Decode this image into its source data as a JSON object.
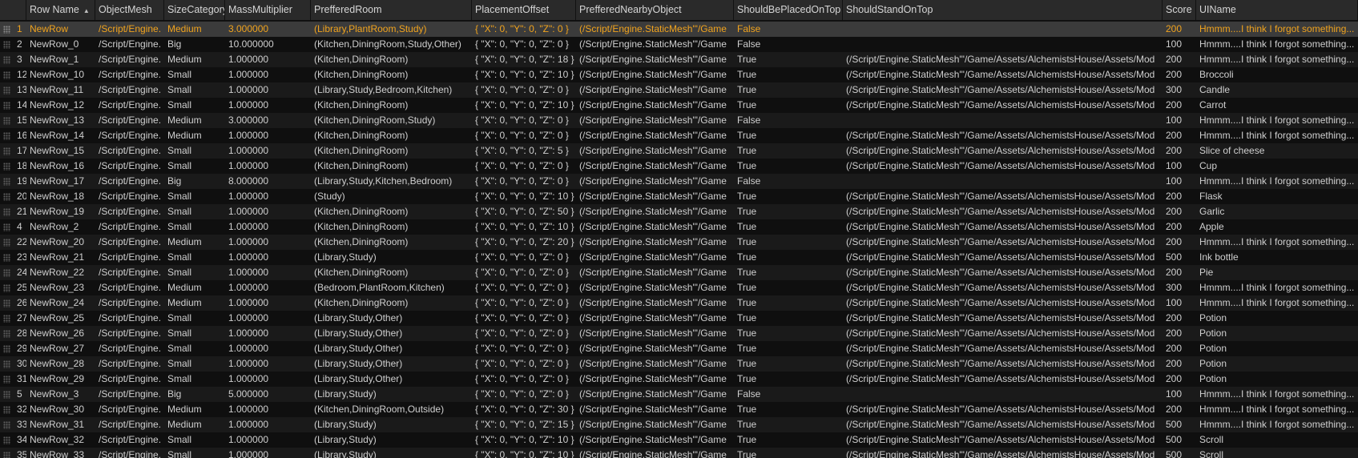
{
  "columns": [
    {
      "key": "rowname",
      "label": "Row Name"
    },
    {
      "key": "mesh",
      "label": "ObjectMesh"
    },
    {
      "key": "size",
      "label": "SizeCategory"
    },
    {
      "key": "mass",
      "label": "MassMultiplier"
    },
    {
      "key": "room",
      "label": "PrefferedRoom"
    },
    {
      "key": "offset",
      "label": "PlacementOffset"
    },
    {
      "key": "nearby",
      "label": "PrefferedNearbyObject"
    },
    {
      "key": "placed",
      "label": "ShouldBePlacedOnTop"
    },
    {
      "key": "stand",
      "label": "ShouldStandOnTop"
    },
    {
      "key": "score",
      "label": "Score"
    },
    {
      "key": "uiname",
      "label": "UIName"
    }
  ],
  "sort": {
    "column": "Row Name",
    "direction": "ascending",
    "indicator": "▲"
  },
  "selected_row_index": 0,
  "rows": [
    {
      "idx": "1",
      "rowname": "NewRow",
      "mesh": "/Script/Engine.",
      "size": "Medium",
      "mass": "3.000000",
      "room": "(Library,PlantRoom,Study)",
      "offset": "{ \"X\": 0, \"Y\": 0, \"Z\": 0 }",
      "nearby": "(/Script/Engine.StaticMesh'\"/Game",
      "placed": "False",
      "stand": "",
      "score": "200",
      "uiname": "Hmmm....I think I forgot something..."
    },
    {
      "idx": "2",
      "rowname": "NewRow_0",
      "mesh": "/Script/Engine.",
      "size": "Big",
      "mass": "10.000000",
      "room": "(Kitchen,DiningRoom,Study,Other)",
      "offset": "{ \"X\": 0, \"Y\": 0, \"Z\": 0 }",
      "nearby": "(/Script/Engine.StaticMesh'\"/Game",
      "placed": "False",
      "stand": "",
      "score": "100",
      "uiname": "Hmmm....I think I forgot something..."
    },
    {
      "idx": "3",
      "rowname": "NewRow_1",
      "mesh": "/Script/Engine.",
      "size": "Medium",
      "mass": "1.000000",
      "room": "(Kitchen,DiningRoom)",
      "offset": "{ \"X\": 0, \"Y\": 0, \"Z\": 18 }",
      "nearby": "(/Script/Engine.StaticMesh'\"/Game",
      "placed": "True",
      "stand": "(/Script/Engine.StaticMesh'\"/Game/Assets/AlchemistsHouse/Assets/Mod",
      "score": "200",
      "uiname": "Hmmm....I think I forgot something..."
    },
    {
      "idx": "12",
      "rowname": "NewRow_10",
      "mesh": "/Script/Engine.",
      "size": "Small",
      "mass": "1.000000",
      "room": "(Kitchen,DiningRoom)",
      "offset": "{ \"X\": 0, \"Y\": 0, \"Z\": 10 }",
      "nearby": "(/Script/Engine.StaticMesh'\"/Game",
      "placed": "True",
      "stand": "(/Script/Engine.StaticMesh'\"/Game/Assets/AlchemistsHouse/Assets/Mod",
      "score": "200",
      "uiname": "Broccoli"
    },
    {
      "idx": "13",
      "rowname": "NewRow_11",
      "mesh": "/Script/Engine.",
      "size": "Small",
      "mass": "1.000000",
      "room": "(Library,Study,Bedroom,Kitchen)",
      "offset": "{ \"X\": 0, \"Y\": 0, \"Z\": 0 }",
      "nearby": "(/Script/Engine.StaticMesh'\"/Game",
      "placed": "True",
      "stand": "(/Script/Engine.StaticMesh'\"/Game/Assets/AlchemistsHouse/Assets/Mod",
      "score": "300",
      "uiname": "Candle"
    },
    {
      "idx": "14",
      "rowname": "NewRow_12",
      "mesh": "/Script/Engine.",
      "size": "Small",
      "mass": "1.000000",
      "room": "(Kitchen,DiningRoom)",
      "offset": "{ \"X\": 0, \"Y\": 0, \"Z\": 10 }",
      "nearby": "(/Script/Engine.StaticMesh'\"/Game",
      "placed": "True",
      "stand": "(/Script/Engine.StaticMesh'\"/Game/Assets/AlchemistsHouse/Assets/Mod",
      "score": "200",
      "uiname": "Carrot"
    },
    {
      "idx": "15",
      "rowname": "NewRow_13",
      "mesh": "/Script/Engine.",
      "size": "Medium",
      "mass": "3.000000",
      "room": "(Kitchen,DiningRoom,Study)",
      "offset": "{ \"X\": 0, \"Y\": 0, \"Z\": 0 }",
      "nearby": "(/Script/Engine.StaticMesh'\"/Game",
      "placed": "False",
      "stand": "",
      "score": "100",
      "uiname": "Hmmm....I think I forgot something..."
    },
    {
      "idx": "16",
      "rowname": "NewRow_14",
      "mesh": "/Script/Engine.",
      "size": "Medium",
      "mass": "1.000000",
      "room": "(Kitchen,DiningRoom)",
      "offset": "{ \"X\": 0, \"Y\": 0, \"Z\": 0 }",
      "nearby": "(/Script/Engine.StaticMesh'\"/Game",
      "placed": "True",
      "stand": "(/Script/Engine.StaticMesh'\"/Game/Assets/AlchemistsHouse/Assets/Mod",
      "score": "200",
      "uiname": "Hmmm....I think I forgot something..."
    },
    {
      "idx": "17",
      "rowname": "NewRow_15",
      "mesh": "/Script/Engine.",
      "size": "Small",
      "mass": "1.000000",
      "room": "(Kitchen,DiningRoom)",
      "offset": "{ \"X\": 0, \"Y\": 0, \"Z\": 5 }",
      "nearby": "(/Script/Engine.StaticMesh'\"/Game",
      "placed": "True",
      "stand": "(/Script/Engine.StaticMesh'\"/Game/Assets/AlchemistsHouse/Assets/Mod",
      "score": "200",
      "uiname": "Slice of cheese"
    },
    {
      "idx": "18",
      "rowname": "NewRow_16",
      "mesh": "/Script/Engine.",
      "size": "Small",
      "mass": "1.000000",
      "room": "(Kitchen,DiningRoom)",
      "offset": "{ \"X\": 0, \"Y\": 0, \"Z\": 0 }",
      "nearby": "(/Script/Engine.StaticMesh'\"/Game",
      "placed": "True",
      "stand": "(/Script/Engine.StaticMesh'\"/Game/Assets/AlchemistsHouse/Assets/Mod",
      "score": "100",
      "uiname": "Cup"
    },
    {
      "idx": "19",
      "rowname": "NewRow_17",
      "mesh": "/Script/Engine.",
      "size": "Big",
      "mass": "8.000000",
      "room": "(Library,Study,Kitchen,Bedroom)",
      "offset": "{ \"X\": 0, \"Y\": 0, \"Z\": 0 }",
      "nearby": "(/Script/Engine.StaticMesh'\"/Game",
      "placed": "False",
      "stand": "",
      "score": "100",
      "uiname": "Hmmm....I think I forgot something..."
    },
    {
      "idx": "20",
      "rowname": "NewRow_18",
      "mesh": "/Script/Engine.",
      "size": "Small",
      "mass": "1.000000",
      "room": "(Study)",
      "offset": "{ \"X\": 0, \"Y\": 0, \"Z\": 10 }",
      "nearby": "(/Script/Engine.StaticMesh'\"/Game",
      "placed": "True",
      "stand": "(/Script/Engine.StaticMesh'\"/Game/Assets/AlchemistsHouse/Assets/Mod",
      "score": "200",
      "uiname": "Flask"
    },
    {
      "idx": "21",
      "rowname": "NewRow_19",
      "mesh": "/Script/Engine.",
      "size": "Small",
      "mass": "1.000000",
      "room": "(Kitchen,DiningRoom)",
      "offset": "{ \"X\": 0, \"Y\": 0, \"Z\": 50 }",
      "nearby": "(/Script/Engine.StaticMesh'\"/Game",
      "placed": "True",
      "stand": "(/Script/Engine.StaticMesh'\"/Game/Assets/AlchemistsHouse/Assets/Mod",
      "score": "200",
      "uiname": "Garlic"
    },
    {
      "idx": "4",
      "rowname": "NewRow_2",
      "mesh": "/Script/Engine.",
      "size": "Small",
      "mass": "1.000000",
      "room": "(Kitchen,DiningRoom)",
      "offset": "{ \"X\": 0, \"Y\": 0, \"Z\": 10 }",
      "nearby": "(/Script/Engine.StaticMesh'\"/Game",
      "placed": "True",
      "stand": "(/Script/Engine.StaticMesh'\"/Game/Assets/AlchemistsHouse/Assets/Mod",
      "score": "200",
      "uiname": "Apple"
    },
    {
      "idx": "22",
      "rowname": "NewRow_20",
      "mesh": "/Script/Engine.",
      "size": "Medium",
      "mass": "1.000000",
      "room": "(Kitchen,DiningRoom)",
      "offset": "{ \"X\": 0, \"Y\": 0, \"Z\": 20 }",
      "nearby": "(/Script/Engine.StaticMesh'\"/Game",
      "placed": "True",
      "stand": "(/Script/Engine.StaticMesh'\"/Game/Assets/AlchemistsHouse/Assets/Mod",
      "score": "200",
      "uiname": "Hmmm....I think I forgot something..."
    },
    {
      "idx": "23",
      "rowname": "NewRow_21",
      "mesh": "/Script/Engine.",
      "size": "Small",
      "mass": "1.000000",
      "room": "(Library,Study)",
      "offset": "{ \"X\": 0, \"Y\": 0, \"Z\": 0 }",
      "nearby": "(/Script/Engine.StaticMesh'\"/Game",
      "placed": "True",
      "stand": "(/Script/Engine.StaticMesh'\"/Game/Assets/AlchemistsHouse/Assets/Mod",
      "score": "500",
      "uiname": "Ink bottle"
    },
    {
      "idx": "24",
      "rowname": "NewRow_22",
      "mesh": "/Script/Engine.",
      "size": "Small",
      "mass": "1.000000",
      "room": "(Kitchen,DiningRoom)",
      "offset": "{ \"X\": 0, \"Y\": 0, \"Z\": 0 }",
      "nearby": "(/Script/Engine.StaticMesh'\"/Game",
      "placed": "True",
      "stand": "(/Script/Engine.StaticMesh'\"/Game/Assets/AlchemistsHouse/Assets/Mod",
      "score": "200",
      "uiname": "Pie"
    },
    {
      "idx": "25",
      "rowname": "NewRow_23",
      "mesh": "/Script/Engine.",
      "size": "Medium",
      "mass": "1.000000",
      "room": "(Bedroom,PlantRoom,Kitchen)",
      "offset": "{ \"X\": 0, \"Y\": 0, \"Z\": 0 }",
      "nearby": "(/Script/Engine.StaticMesh'\"/Game",
      "placed": "True",
      "stand": "(/Script/Engine.StaticMesh'\"/Game/Assets/AlchemistsHouse/Assets/Mod",
      "score": "300",
      "uiname": "Hmmm....I think I forgot something..."
    },
    {
      "idx": "26",
      "rowname": "NewRow_24",
      "mesh": "/Script/Engine.",
      "size": "Medium",
      "mass": "1.000000",
      "room": "(Kitchen,DiningRoom)",
      "offset": "{ \"X\": 0, \"Y\": 0, \"Z\": 0 }",
      "nearby": "(/Script/Engine.StaticMesh'\"/Game",
      "placed": "True",
      "stand": "(/Script/Engine.StaticMesh'\"/Game/Assets/AlchemistsHouse/Assets/Mod",
      "score": "100",
      "uiname": "Hmmm....I think I forgot something..."
    },
    {
      "idx": "27",
      "rowname": "NewRow_25",
      "mesh": "/Script/Engine.",
      "size": "Small",
      "mass": "1.000000",
      "room": "(Library,Study,Other)",
      "offset": "{ \"X\": 0, \"Y\": 0, \"Z\": 0 }",
      "nearby": "(/Script/Engine.StaticMesh'\"/Game",
      "placed": "True",
      "stand": "(/Script/Engine.StaticMesh'\"/Game/Assets/AlchemistsHouse/Assets/Mod",
      "score": "200",
      "uiname": "Potion"
    },
    {
      "idx": "28",
      "rowname": "NewRow_26",
      "mesh": "/Script/Engine.",
      "size": "Small",
      "mass": "1.000000",
      "room": "(Library,Study,Other)",
      "offset": "{ \"X\": 0, \"Y\": 0, \"Z\": 0 }",
      "nearby": "(/Script/Engine.StaticMesh'\"/Game",
      "placed": "True",
      "stand": "(/Script/Engine.StaticMesh'\"/Game/Assets/AlchemistsHouse/Assets/Mod",
      "score": "200",
      "uiname": "Potion"
    },
    {
      "idx": "29",
      "rowname": "NewRow_27",
      "mesh": "/Script/Engine.",
      "size": "Small",
      "mass": "1.000000",
      "room": "(Library,Study,Other)",
      "offset": "{ \"X\": 0, \"Y\": 0, \"Z\": 0 }",
      "nearby": "(/Script/Engine.StaticMesh'\"/Game",
      "placed": "True",
      "stand": "(/Script/Engine.StaticMesh'\"/Game/Assets/AlchemistsHouse/Assets/Mod",
      "score": "200",
      "uiname": "Potion"
    },
    {
      "idx": "30",
      "rowname": "NewRow_28",
      "mesh": "/Script/Engine.",
      "size": "Small",
      "mass": "1.000000",
      "room": "(Library,Study,Other)",
      "offset": "{ \"X\": 0, \"Y\": 0, \"Z\": 0 }",
      "nearby": "(/Script/Engine.StaticMesh'\"/Game",
      "placed": "True",
      "stand": "(/Script/Engine.StaticMesh'\"/Game/Assets/AlchemistsHouse/Assets/Mod",
      "score": "200",
      "uiname": "Potion"
    },
    {
      "idx": "31",
      "rowname": "NewRow_29",
      "mesh": "/Script/Engine.",
      "size": "Small",
      "mass": "1.000000",
      "room": "(Library,Study,Other)",
      "offset": "{ \"X\": 0, \"Y\": 0, \"Z\": 0 }",
      "nearby": "(/Script/Engine.StaticMesh'\"/Game",
      "placed": "True",
      "stand": "(/Script/Engine.StaticMesh'\"/Game/Assets/AlchemistsHouse/Assets/Mod",
      "score": "200",
      "uiname": "Potion"
    },
    {
      "idx": "5",
      "rowname": "NewRow_3",
      "mesh": "/Script/Engine.",
      "size": "Big",
      "mass": "5.000000",
      "room": "(Library,Study)",
      "offset": "{ \"X\": 0, \"Y\": 0, \"Z\": 0 }",
      "nearby": "(/Script/Engine.StaticMesh'\"/Game",
      "placed": "False",
      "stand": "",
      "score": "100",
      "uiname": "Hmmm....I think I forgot something..."
    },
    {
      "idx": "32",
      "rowname": "NewRow_30",
      "mesh": "/Script/Engine.",
      "size": "Medium",
      "mass": "1.000000",
      "room": "(Kitchen,DiningRoom,Outside)",
      "offset": "{ \"X\": 0, \"Y\": 0, \"Z\": 30 }",
      "nearby": "(/Script/Engine.StaticMesh'\"/Game",
      "placed": "True",
      "stand": "(/Script/Engine.StaticMesh'\"/Game/Assets/AlchemistsHouse/Assets/Mod",
      "score": "200",
      "uiname": "Hmmm....I think I forgot something..."
    },
    {
      "idx": "33",
      "rowname": "NewRow_31",
      "mesh": "/Script/Engine.",
      "size": "Medium",
      "mass": "1.000000",
      "room": "(Library,Study)",
      "offset": "{ \"X\": 0, \"Y\": 0, \"Z\": 15 }",
      "nearby": "(/Script/Engine.StaticMesh'\"/Game",
      "placed": "True",
      "stand": "(/Script/Engine.StaticMesh'\"/Game/Assets/AlchemistsHouse/Assets/Mod",
      "score": "500",
      "uiname": "Hmmm....I think I forgot something..."
    },
    {
      "idx": "34",
      "rowname": "NewRow_32",
      "mesh": "/Script/Engine.",
      "size": "Small",
      "mass": "1.000000",
      "room": "(Library,Study)",
      "offset": "{ \"X\": 0, \"Y\": 0, \"Z\": 10 }",
      "nearby": "(/Script/Engine.StaticMesh'\"/Game",
      "placed": "True",
      "stand": "(/Script/Engine.StaticMesh'\"/Game/Assets/AlchemistsHouse/Assets/Mod",
      "score": "500",
      "uiname": "Scroll"
    },
    {
      "idx": "35",
      "rowname": "NewRow_33",
      "mesh": "/Script/Engine.",
      "size": "Small",
      "mass": "1.000000",
      "room": "(Library,Study)",
      "offset": "{ \"X\": 0, \"Y\": 0, \"Z\": 10 }",
      "nearby": "(/Script/Engine.StaticMesh'\"/Game",
      "placed": "True",
      "stand": "(/Script/Engine.StaticMesh'\"/Game/Assets/AlchemistsHouse/Assets/Mod",
      "score": "500",
      "uiname": "Scroll"
    }
  ]
}
